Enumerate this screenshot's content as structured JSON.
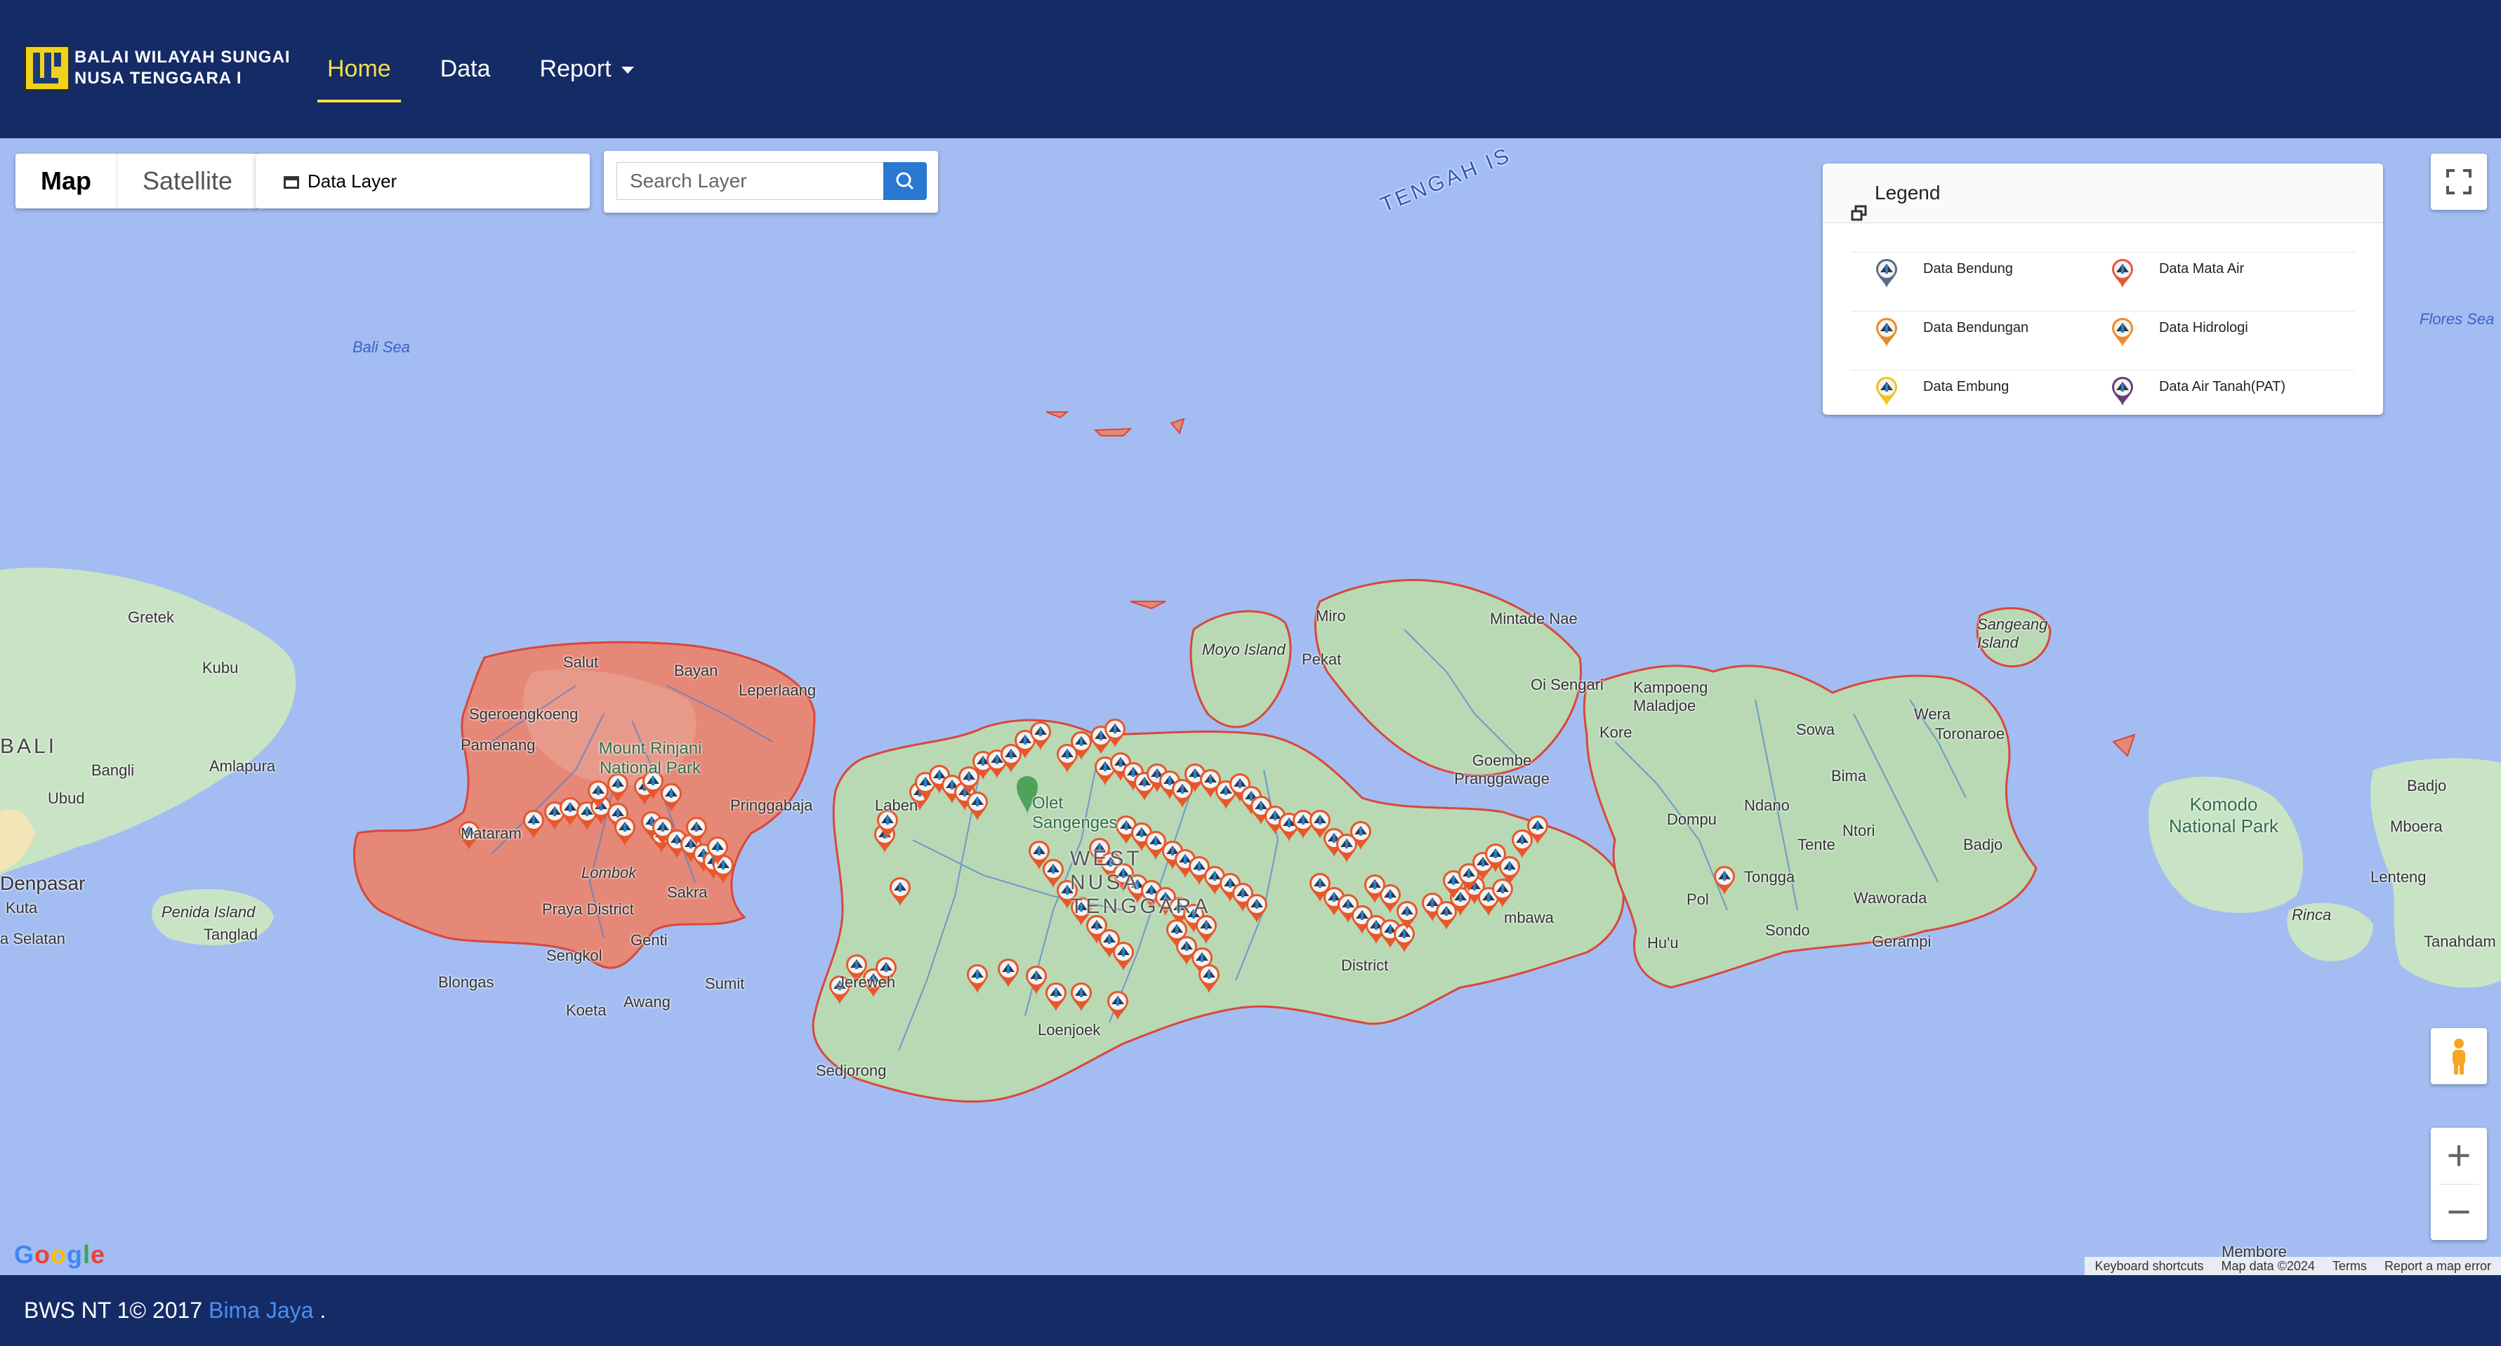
{
  "header": {
    "brand_line1": "BALAI  WILAYAH SUNGAI",
    "brand_line2": "NUSA TENGGARA I",
    "nav": [
      {
        "label": "Home",
        "active": true
      },
      {
        "label": "Data",
        "active": false
      },
      {
        "label": "Report",
        "active": false,
        "dropdown": true
      }
    ]
  },
  "map": {
    "map_type": {
      "map": "Map",
      "satellite": "Satellite",
      "selected": "Map"
    },
    "data_layer_label": "Data Layer",
    "search": {
      "placeholder": "Search Layer",
      "icon": "search-icon"
    },
    "legend": {
      "title": "Legend",
      "items": [
        {
          "label": "Data Bendung",
          "color": "#5a6d8a"
        },
        {
          "label": "Data Mata Air",
          "color": "#e8573a"
        },
        {
          "label": "Data Bendungan",
          "color": "#e88d2a"
        },
        {
          "label": "Data Hidrologi",
          "color": "#f08a2a"
        },
        {
          "label": "Data Embung",
          "color": "#f2c21a"
        },
        {
          "label": "Data Air Tanah(PAT)",
          "color": "#6a3d7a"
        }
      ]
    },
    "labels": {
      "bali_sea": "Bali Sea",
      "flores_sea": "Flores Sea",
      "tengah": "TENGAH IS",
      "bali": "BALI",
      "gretek": "Gretek",
      "kubu": "Kubu",
      "bangli": "Bangli",
      "amlapura": "Amlapura",
      "ubud": "Ubud",
      "denpasar": "Denpasar",
      "kuta": "Kuta",
      "selatan": "a Selatan",
      "penida": "Penida Island",
      "tanglad": "Tanglad",
      "salut": "Salut",
      "bayan": "Bayan",
      "leperlaang": "Leperlaang",
      "sgeroengkoeng": "Sgeroengkoeng",
      "pamenang": "Pamenang",
      "rinjani": "Mount Rinjani National Park",
      "mataram": "Mataram",
      "lombok": "Lombok",
      "pringgabaja": "Pringgabaja",
      "praya": "Praya District",
      "sakra": "Sakra",
      "senggigi": "Sengkol",
      "genti": "Genti",
      "blongas": "Blongas",
      "koeta": "Koeta",
      "awang": "Awang",
      "sumit": "Sumit",
      "laben": "Laben",
      "olet": "Olet Sangenges",
      "west": "WEST NUSA TENGGARA",
      "jereweh": "Jereweh",
      "loenjoek": "Loenjoek",
      "sedjorong": "Sedjorong",
      "moyo": "Moyo Island",
      "pekat": "Pekat",
      "miro": "Miro",
      "mintade": "Mintade Nae",
      "sengari": "Oi Sengari",
      "kampoeng": "Kampoeng Maladjoe",
      "kore": "Kore",
      "sowa": "Sowa",
      "wera": "Wera",
      "toronaroe": "Toronaroe",
      "bima": "Bima",
      "dompu": "Dompu",
      "ndano": "Ndano",
      "ntori": "Ntori",
      "badjo": "Badjo",
      "tente": "Tente",
      "tongga": "Tongga",
      "waworada": "Waworada",
      "sondo": "Sondo",
      "gerampi": "Gerampi",
      "huu": "Hu'u",
      "pol": "Pol",
      "sangeang": "Sangeang Island",
      "komodo": "Komodo National Park",
      "badjo2": "Badjo",
      "mboera": "Mboera",
      "lenteng": "Lenteng",
      "rinca": "Rinca",
      "tanahdam": "Tanahdam",
      "membore": "Membore",
      "goembe": "Goembe Pranggawage",
      "district": "District",
      "sumbawa": "mbawa"
    },
    "attribution": [
      "Keyboard shortcuts",
      "Map data ©2024",
      "Terms",
      "Report a map error"
    ],
    "google": "Google"
  },
  "footer": {
    "text": "BWS NT 1© 2017 ",
    "link": "Bima Jaya",
    "tail": " ."
  }
}
